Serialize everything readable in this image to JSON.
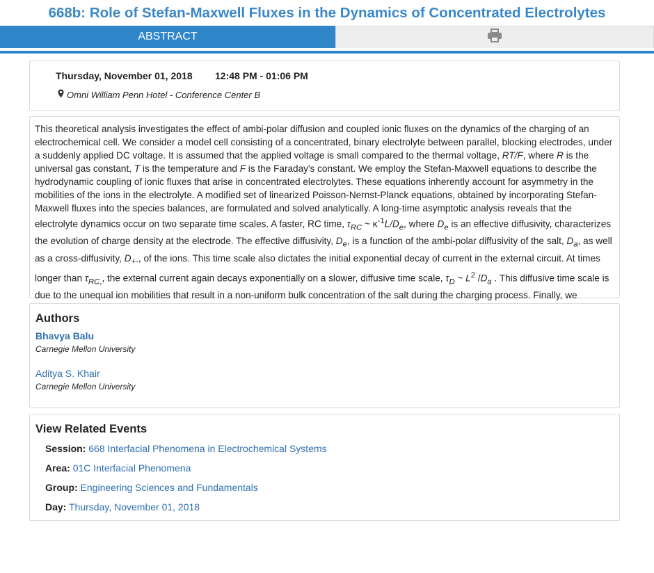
{
  "page": {
    "title": "668b: Role of Stefan-Maxwell Fluxes in the Dynamics of Concentrated Electrolytes"
  },
  "tabs": {
    "abstract_label": "ABSTRACT",
    "print_icon": "printer-icon"
  },
  "event": {
    "date": "Thursday, November 01, 2018",
    "time": "12:48 PM - 01:06 PM",
    "location": "Omni William Penn Hotel - Conference Center B"
  },
  "abstract": {
    "p1": "This theoretical analysis investigates the effect of ambi-polar diffusion and coupled ionic fluxes on the dynamics of the charging of an electrochemical cell. We consider a model cell consisting of a concentrated, binary electrolyte between parallel, blocking electrodes, under a suddenly applied DC voltage. It is assumed that the applied voltage is small compared to the thermal voltage, ",
    "rtf": "RT/F",
    "p2": ", where ",
    "r": "R",
    "p3": " is the universal gas constant, ",
    "t": "T",
    "p4": " is the temperature and ",
    "f": "F",
    "p5": " is the Faraday's constant. We employ the Stefan-Maxwell equations to describe the hydrodynamic coupling of ionic fluxes that arise in concentrated electrolytes. These equations inherently account for asymmetry in the mobilities of the ions in the electrolyte. A modified set of linearized Poisson-Nernst-Planck equations, obtained by incorporating Stefan-Maxwell fluxes into the species balances, are formulated and solved analytically. A long-time asymptotic analysis reveals that the electrolyte dynamics occur on two separate time scales. A faster, RC time, ",
    "tau": "τ",
    "rc": "RC",
    "approx": " ~ κ",
    "minus1": "-1",
    "ld": "L/D",
    "e": "e",
    "p6": ", where ",
    "d": "D",
    "p7": " is an effective diffusivity, characterizes the evolution of charge density at the electrode. The effective diffusivity, ",
    "p8": ", is a function of the ambi-polar diffusivity of the salt, ",
    "a": "a",
    "p9": ", as well as a cross-diffusivity, ",
    "pm": "+-",
    "p10": ", of the ions. This time scale also dictates the initial exponential decay of current in the external circuit. At times longer than ",
    "rc_comma": "RC",
    "p11": ", the external current again decays exponentially on a slower, diffusive time scale, ",
    "dsub": "D",
    "approx2": " ~ ",
    "l": "L",
    "two": "2",
    "slash": " /",
    "p12": " . This diffusive time scale is due to the unequal ion mobilities that result in a non-uniform bulk concentration of the salt during the charging process. Finally, we demonstrate how these dynamics can be incorporated into an equivalent circuit model.",
    "comma": ","
  },
  "authors": {
    "heading": "Authors",
    "items": [
      {
        "name": "Bhavya Balu",
        "affiliation": "Carnegie Mellon University"
      },
      {
        "name": "Aditya S. Khair",
        "affiliation": "Carnegie Mellon University"
      }
    ]
  },
  "related": {
    "heading": "View Related Events",
    "rows": [
      {
        "label": "Session:",
        "value": "668 Interfacial Phenomena in Electrochemical Systems"
      },
      {
        "label": "Area:",
        "value": "01C Interfacial Phenomena"
      },
      {
        "label": "Group:",
        "value": "Engineering Sciences and Fundamentals"
      },
      {
        "label": "Day:",
        "value": "Thursday, November 01, 2018"
      }
    ]
  },
  "colors": {
    "accent": "#2e86c9",
    "link": "#2f6fb0",
    "title": "#3a87c8"
  }
}
